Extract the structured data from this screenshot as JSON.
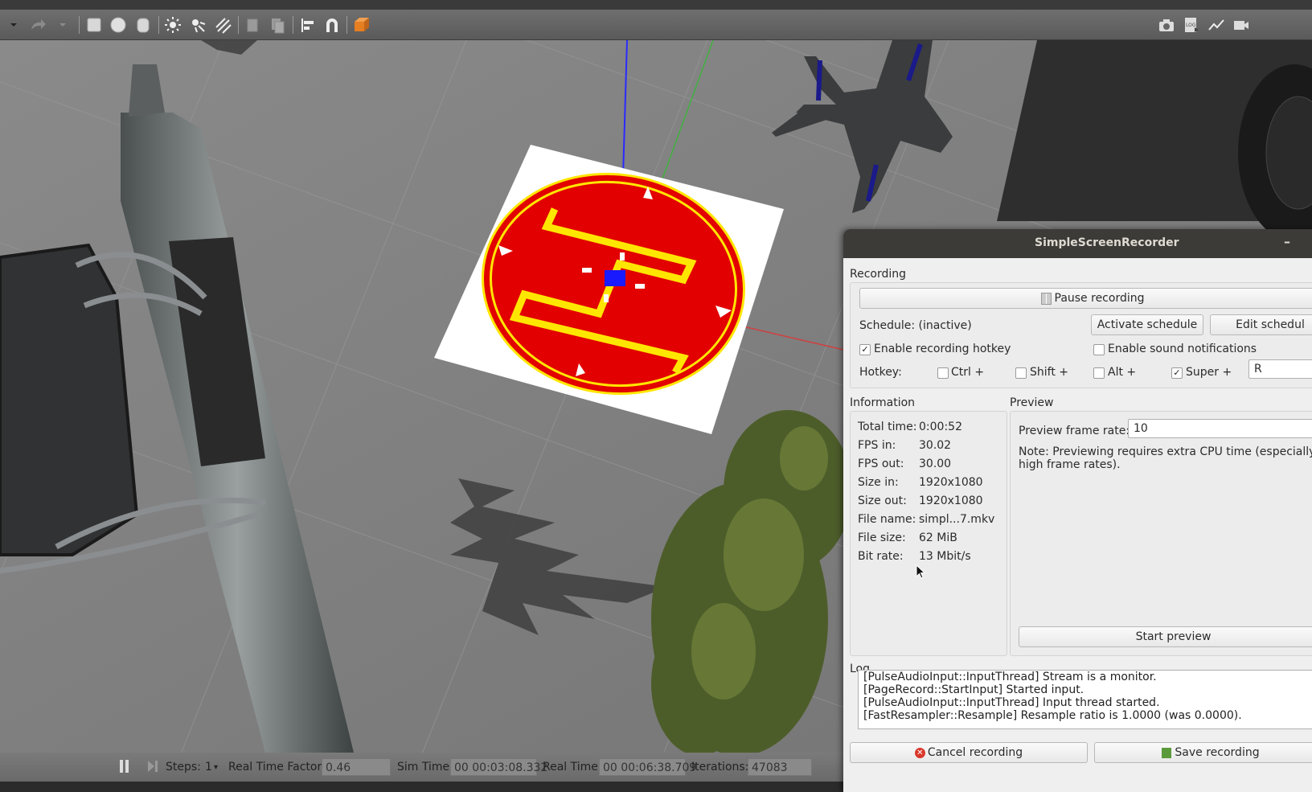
{
  "toolbar": {
    "items": [
      "undo-dropdown",
      "redo",
      "redo-dropdown",
      "box",
      "sphere",
      "cylinder",
      "point-light",
      "spot-light",
      "directional-light",
      "copy",
      "paste",
      "align",
      "snap",
      "view-angle"
    ],
    "right_icons": [
      "camera-icon",
      "log-icon",
      "plot-icon",
      "video-icon"
    ]
  },
  "status": {
    "steps_label": "Steps:",
    "steps_value": "1",
    "rtf_label": "Real Time Factor:",
    "rtf_value": "0.46",
    "sim_label": "Sim Time:",
    "sim_value": "00 00:03:08.332",
    "real_label": "Real Time:",
    "real_value": "00 00:06:38.709",
    "iter_label": "Iterations:",
    "iter_value": "47083"
  },
  "recorder": {
    "title": "SimpleScreenRecorder",
    "minimize": "–",
    "recording": {
      "section": "Recording",
      "pause_label": "Pause recording",
      "schedule_label": "Schedule: (inactive)",
      "activate_label": "Activate schedule",
      "edit_label": "Edit schedul",
      "hotkey_enable_label": "Enable recording hotkey",
      "hotkey_enable_checked": "✓",
      "sound_label": "Enable sound notifications",
      "hotkey_label": "Hotkey:",
      "ctrl_label": "Ctrl +",
      "shift_label": "Shift +",
      "alt_label": "Alt +",
      "super_label": "Super +",
      "super_checked": "✓",
      "key_value": "R"
    },
    "information": {
      "section": "Information",
      "rows": [
        {
          "k": "Total time:",
          "v": "0:00:52"
        },
        {
          "k": "FPS in:",
          "v": "30.02"
        },
        {
          "k": "FPS out:",
          "v": "30.00"
        },
        {
          "k": "Size in:",
          "v": "1920x1080"
        },
        {
          "k": "Size out:",
          "v": "1920x1080"
        },
        {
          "k": "File name:",
          "v": "simpl...7.mkv"
        },
        {
          "k": "File size:",
          "v": "62 MiB"
        },
        {
          "k": "Bit rate:",
          "v": "13 Mbit/s"
        }
      ]
    },
    "preview": {
      "section": "Preview",
      "rate_label": "Preview frame rate:",
      "rate_value": "10",
      "note_line1": "Note: Previewing requires extra CPU time (especially",
      "note_line2": "high frame rates).",
      "start_label": "Start preview"
    },
    "log": {
      "section": "Log",
      "lines": [
        "[PulseAudioInput::InputThread] Stream is a monitor.",
        "[PageRecord::StartInput] Started input.",
        "[PulseAudioInput::InputThread] Input thread started.",
        "[FastResampler::Resample] Resample ratio is 1.0000 (was 0.0000)."
      ]
    },
    "buttons": {
      "cancel_label": "Cancel recording",
      "save_label": "Save recording"
    }
  }
}
